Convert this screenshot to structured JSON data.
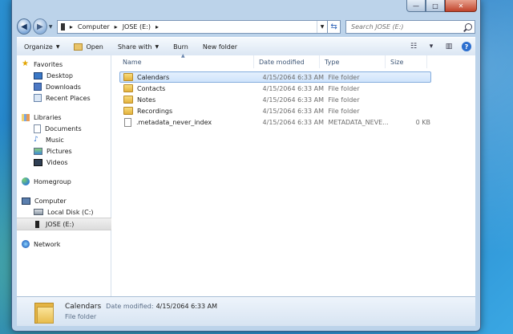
{
  "window": {
    "caption": {
      "minimize": "—",
      "maximize": "□",
      "close": "✕"
    }
  },
  "address": {
    "crumbs": [
      "Computer",
      "JOSE (E:)"
    ],
    "separators": [
      "▸",
      "▸",
      "▸"
    ],
    "search_placeholder": "Search JOSE (E:)"
  },
  "toolbar": {
    "organize": "Organize",
    "open": "Open",
    "share_with": "Share with",
    "burn": "Burn",
    "new_folder": "New folder"
  },
  "navpane": {
    "favorites": {
      "label": "Favorites",
      "items": [
        "Desktop",
        "Downloads",
        "Recent Places"
      ]
    },
    "libraries": {
      "label": "Libraries",
      "items": [
        "Documents",
        "Music",
        "Pictures",
        "Videos"
      ]
    },
    "homegroup": "Homegroup",
    "computer": {
      "label": "Computer",
      "items": [
        "Local Disk (C:)",
        "JOSE (E:)"
      ]
    },
    "network": "Network"
  },
  "columns": {
    "name": "Name",
    "date": "Date modified",
    "type": "Type",
    "size": "Size"
  },
  "files": [
    {
      "name": "Calendars",
      "date": "4/15/2064 6:33 AM",
      "type": "File folder",
      "size": "",
      "kind": "folder",
      "selected": true
    },
    {
      "name": "Contacts",
      "date": "4/15/2064 6:33 AM",
      "type": "File folder",
      "size": "",
      "kind": "folder"
    },
    {
      "name": "Notes",
      "date": "4/15/2064 6:33 AM",
      "type": "File folder",
      "size": "",
      "kind": "folder"
    },
    {
      "name": "Recordings",
      "date": "4/15/2064 6:33 AM",
      "type": "File folder",
      "size": "",
      "kind": "folder"
    },
    {
      "name": ".metadata_never_index",
      "date": "4/15/2064 6:33 AM",
      "type": "METADATA_NEVE...",
      "size": "0 KB",
      "kind": "file"
    }
  ],
  "details": {
    "name": "Calendars",
    "date_label": "Date modified:",
    "date_value": "4/15/2064 6:33 AM",
    "type": "File folder"
  }
}
